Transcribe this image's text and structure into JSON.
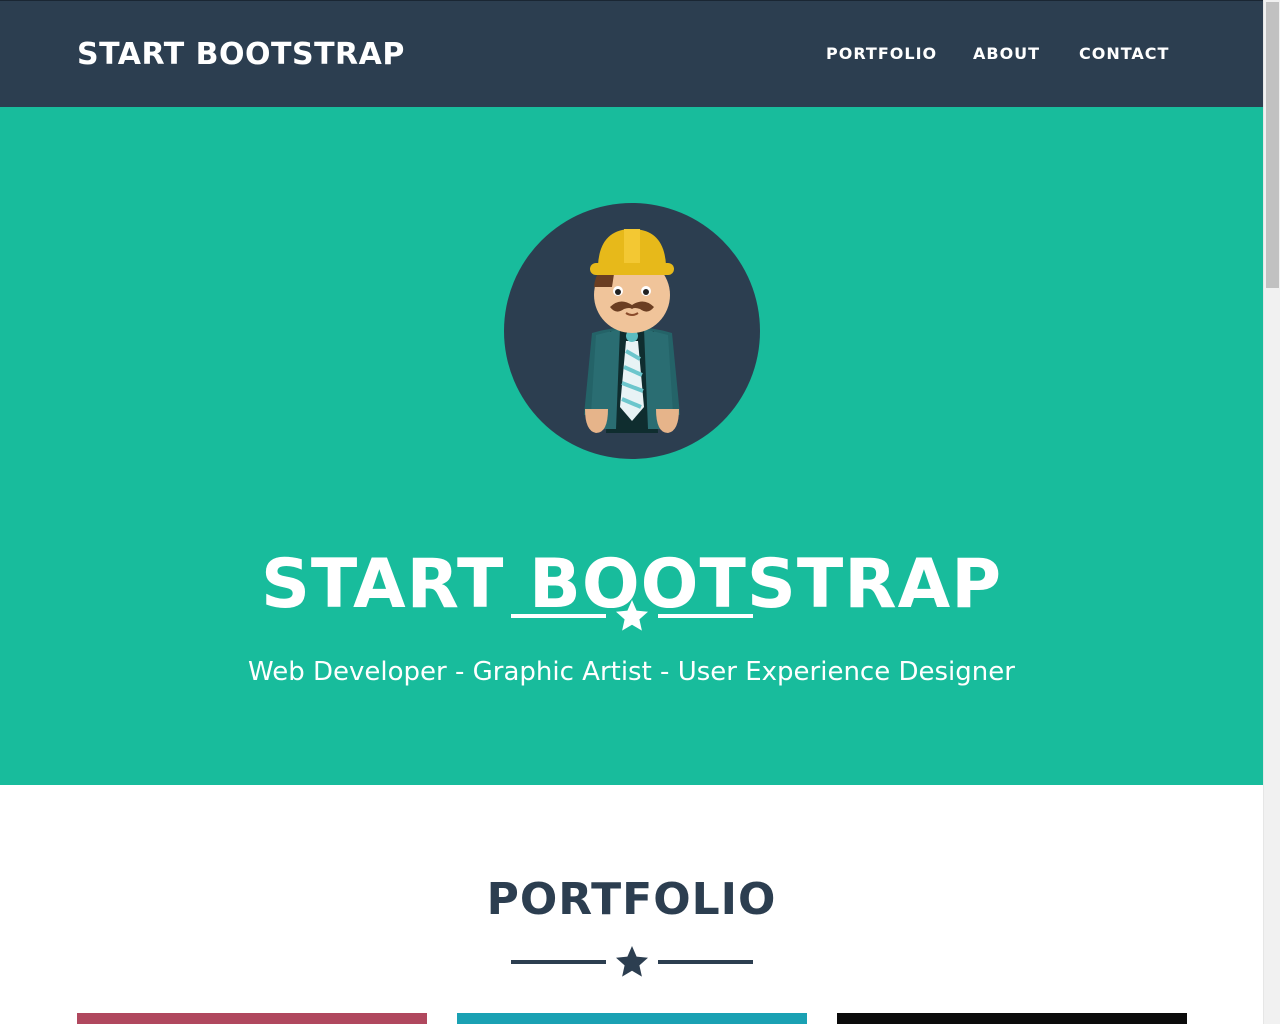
{
  "navbar": {
    "brand": "START BOOTSTRAP",
    "links": [
      {
        "label": "PORTFOLIO"
      },
      {
        "label": "ABOUT"
      },
      {
        "label": "CONTACT"
      }
    ]
  },
  "masthead": {
    "avatar_icon": "construction-worker-avatar-icon",
    "title": "START BOOTSTRAP",
    "divider_icon": "star-icon",
    "subtitle": "Web Developer - Graphic Artist - User Experience Designer"
  },
  "portfolio": {
    "title": "PORTFOLIO",
    "divider_icon": "star-icon"
  },
  "colors": {
    "navbar_bg": "#2c3e50",
    "masthead_bg": "#18bc9c",
    "heading_dark": "#2c3e50",
    "tile_1": "#b0485e",
    "tile_2": "#1aa1b3",
    "tile_3": "#0b0b0b"
  }
}
